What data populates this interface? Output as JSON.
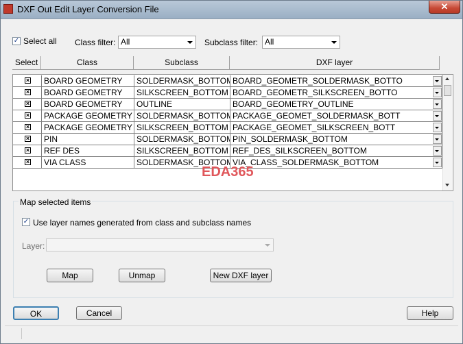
{
  "window": {
    "title": "DXF Out Edit Layer Conversion File",
    "close_label": "✕"
  },
  "filters": {
    "select_all_label": "Select all",
    "select_all_checked": true,
    "class_filter_label": "Class filter:",
    "class_filter_value": "All",
    "subclass_filter_label": "Subclass filter:",
    "subclass_filter_value": "All"
  },
  "grid": {
    "columns": [
      "Select",
      "Class",
      "Subclass",
      "DXF layer"
    ],
    "rows": [
      {
        "selected": true,
        "class": "BOARD GEOMETRY",
        "subclass": "SOLDERMASK_BOTTOM",
        "dxf_layer": "BOARD_GEOMETR_SOLDERMASK_BOTTO"
      },
      {
        "selected": true,
        "class": "BOARD GEOMETRY",
        "subclass": "SILKSCREEN_BOTTOM",
        "dxf_layer": "BOARD_GEOMETR_SILKSCREEN_BOTTO"
      },
      {
        "selected": true,
        "class": "BOARD GEOMETRY",
        "subclass": "OUTLINE",
        "dxf_layer": "BOARD_GEOMETRY_OUTLINE"
      },
      {
        "selected": true,
        "class": "PACKAGE GEOMETRY",
        "subclass": "SOLDERMASK_BOTTOM",
        "dxf_layer": "PACKAGE_GEOMET_SOLDERMASK_BOTT"
      },
      {
        "selected": true,
        "class": "PACKAGE GEOMETRY",
        "subclass": "SILKSCREEN_BOTTOM",
        "dxf_layer": "PACKAGE_GEOMET_SILKSCREEN_BOTT"
      },
      {
        "selected": true,
        "class": "PIN",
        "subclass": "SOLDERMASK_BOTTOM",
        "dxf_layer": "PIN_SOLDERMASK_BOTTOM"
      },
      {
        "selected": true,
        "class": "REF DES",
        "subclass": "SILKSCREEN_BOTTOM",
        "dxf_layer": "REF_DES_SILKSCREEN_BOTTOM"
      },
      {
        "selected": true,
        "class": "VIA CLASS",
        "subclass": "SOLDERMASK_BOTTOM",
        "dxf_layer": "VIA_CLASS_SOLDERMASK_BOTTOM"
      }
    ]
  },
  "watermark": "EDA365",
  "map_group": {
    "title": "Map selected items",
    "use_layer_names_label": "Use layer names generated from class and subclass names",
    "use_layer_names_checked": true,
    "layer_label": "Layer:",
    "layer_value": "",
    "map_button": "Map",
    "unmap_button": "Unmap",
    "new_dxf_layer_button": "New DXF layer"
  },
  "buttons": {
    "ok": "OK",
    "cancel": "Cancel",
    "help": "Help"
  }
}
